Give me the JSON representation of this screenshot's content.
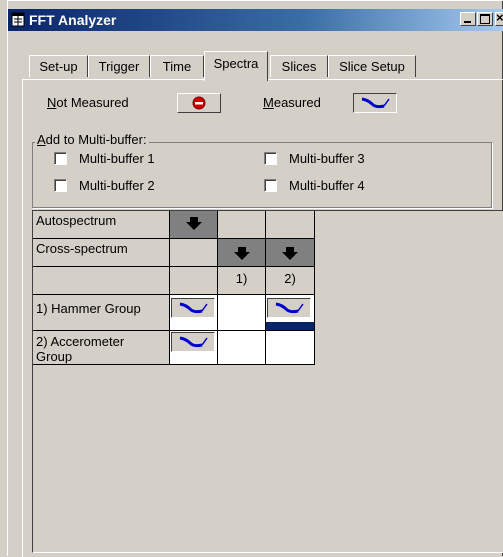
{
  "window": {
    "title": "FFT Analyzer"
  },
  "tabs": [
    {
      "label": "Set-up"
    },
    {
      "label": "Trigger"
    },
    {
      "label": "Time"
    },
    {
      "label": "Spectra"
    },
    {
      "label": "Slices"
    },
    {
      "label": "Slice Setup"
    }
  ],
  "legend": {
    "not_measured_first": "N",
    "not_measured_rest": "ot Measured",
    "measured_first": "M",
    "measured_rest": "easured"
  },
  "multibuffer": {
    "title_first": "A",
    "title_rest": "dd to Multi-buffer:",
    "items": [
      {
        "label": "Multi-buffer 1",
        "checked": false
      },
      {
        "label": "Multi-buffer 2",
        "checked": false
      },
      {
        "label": "Multi-buffer 3",
        "checked": false
      },
      {
        "label": "Multi-buffer 4",
        "checked": false
      }
    ]
  },
  "grid": {
    "row_labels": {
      "autospectrum": "Autospectrum",
      "cross_spectrum": "Cross-spectrum",
      "group1": "1) Hammer Group",
      "group2": "2) Accerometer Group"
    },
    "col_labels": [
      "1)",
      "2)"
    ]
  },
  "colors": {
    "titlebar_start": "#0a246a",
    "titlebar_end": "#a6caf0",
    "face": "#d4d0c8",
    "selection": "#0a246a",
    "measured_icon": "#0000cc",
    "not_measured_icon": "#cc0000"
  },
  "icons": {
    "measured": "curve-icon",
    "not_measured": "no-entry-icon",
    "toggle": "down-arrow-icon"
  }
}
